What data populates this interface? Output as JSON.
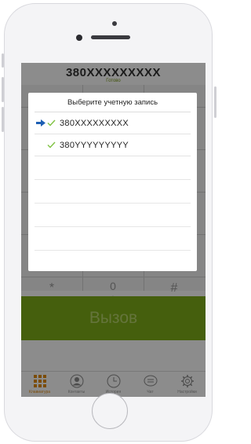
{
  "header": {
    "number": "380XXXXXXXXX",
    "status": "Готово"
  },
  "call_button": {
    "label": "Вызов"
  },
  "keypad": {
    "visible_keys": [
      "*",
      "0",
      "+",
      "#"
    ]
  },
  "tabbar": {
    "items": [
      {
        "label": "Клавиатура",
        "icon": "keypad-icon",
        "active": true
      },
      {
        "label": "Контакты",
        "icon": "contact-icon",
        "active": false
      },
      {
        "label": "История",
        "icon": "clock-icon",
        "active": false
      },
      {
        "label": "Чат",
        "icon": "chat-icon",
        "active": false
      },
      {
        "label": "Настройки",
        "icon": "gear-icon",
        "active": false
      }
    ]
  },
  "dialog": {
    "title": "Выберите учетную запись",
    "accounts": [
      {
        "number": "380XXXXXXXXX",
        "selected": true
      },
      {
        "number": "380YYYYYYYYY",
        "selected": false
      }
    ]
  },
  "colors": {
    "accent_green": "#7fae18",
    "active_tab": "#e08a10",
    "check_green": "#7fc241",
    "arrow_blue": "#1e5fb4"
  }
}
